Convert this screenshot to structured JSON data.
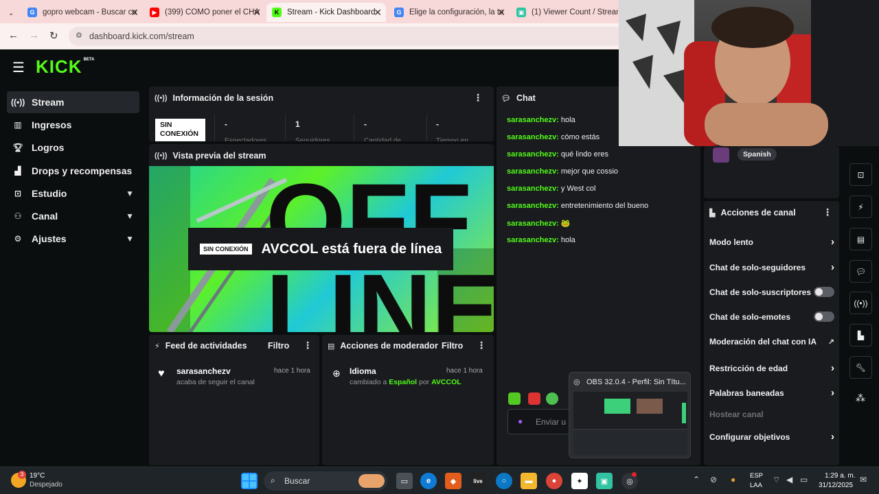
{
  "browser": {
    "tabs": [
      {
        "title": "gopro webcam - Buscar co",
        "fav": "G"
      },
      {
        "title": "(399) COMO poner el CHA",
        "fav": "▶"
      },
      {
        "title": "Stream - Kick Dashboard",
        "fav": "K"
      },
      {
        "title": "Elige la configuración, la ta",
        "fav": "G"
      },
      {
        "title": "(1) Viewer Count / Stream",
        "fav": "▣"
      }
    ],
    "url": "dashboard.kick.com/stream"
  },
  "logo": {
    "text": "KICK",
    "badge": "BETA"
  },
  "sidebar": {
    "items": [
      {
        "label": "Stream",
        "icon": "broadcast-icon"
      },
      {
        "label": "Ingresos",
        "icon": "chart-icon"
      },
      {
        "label": "Logros",
        "icon": "trophy-icon"
      },
      {
        "label": "Drops y recompensas",
        "icon": "drops-icon"
      },
      {
        "label": "Estudio",
        "icon": "studio-icon"
      },
      {
        "label": "Canal",
        "icon": "channel-icon"
      },
      {
        "label": "Ajustes",
        "icon": "gear-icon"
      }
    ]
  },
  "session": {
    "title": "Información de la sesión",
    "status": "SIN CONEXIÓN",
    "stats": [
      {
        "value": "-",
        "label": "Espectadores"
      },
      {
        "value": "1",
        "label": "Seguidores"
      },
      {
        "value": "-",
        "label": "Cantidad de"
      },
      {
        "value": "-",
        "label": "Tiempo en"
      }
    ]
  },
  "preview": {
    "title": "Vista previa del stream",
    "badge": "SIN CONEXIÓN",
    "message": "AVCCOL está fuera de línea"
  },
  "feed": {
    "title": "Feed de actividades",
    "filter": "Filtro",
    "item": {
      "user": "sarasanchezv",
      "text": "acaba de seguir el canal",
      "time": "hace 1 hora"
    }
  },
  "mod": {
    "title": "Acciones de moderador",
    "filter": "Filtro",
    "item": {
      "title": "Idioma",
      "pre": "cambiado a",
      "lang": "Español",
      "by": "por",
      "user": "AVCCOL",
      "time": "hace 1 hora"
    }
  },
  "chat": {
    "title": "Chat",
    "messages": [
      {
        "user": "sarasanchezv:",
        "text": "hola"
      },
      {
        "user": "sarasanchezv:",
        "text": "cómo estás"
      },
      {
        "user": "sarasanchezv:",
        "text": "qué lindo eres"
      },
      {
        "user": "sarasanchezv:",
        "text": "mejor que cossio"
      },
      {
        "user": "sarasanchezv:",
        "text": "y West col"
      },
      {
        "user": "sarasanchezv:",
        "text": "entretenimiento del bueno"
      },
      {
        "user": "sarasanchezv:",
        "text": "🐸"
      },
      {
        "user": "sarasanchezv:",
        "text": "hola"
      }
    ],
    "input_placeholder": "Enviar u"
  },
  "language_tag": "Spanish",
  "channel_actions": {
    "title": "Acciones de canal",
    "items": [
      {
        "label": "Modo lento",
        "control": "chevron"
      },
      {
        "label": "Chat de solo-seguidores",
        "control": "chevron"
      },
      {
        "label": "Chat de solo-suscriptores",
        "control": "toggle"
      },
      {
        "label": "Chat de solo-emotes",
        "control": "toggle"
      },
      {
        "label": "Moderación del chat con IA",
        "control": "external"
      },
      {
        "label": "Restricción de edad",
        "control": "chevron"
      },
      {
        "label": "Palabras baneadas",
        "control": "chevron"
      },
      {
        "label": "Hostear canal",
        "control": "disabled"
      },
      {
        "label": "Configurar objetivos",
        "control": "chevron"
      }
    ]
  },
  "obs_popup": {
    "title": "OBS 32.0.4 - Perfil: Sin Títu..."
  },
  "taskbar": {
    "weather_temp": "19°C",
    "weather_desc": "Despejado",
    "weather_badge": "3",
    "search": "Buscar",
    "lang_top": "ESP",
    "lang_bottom": "LAA",
    "time": "1:29 a. m.",
    "date": "31/12/2025"
  },
  "colors": {
    "accent": "#53fc18",
    "panel": "#191b1f",
    "bg": "#0b0e0f"
  }
}
